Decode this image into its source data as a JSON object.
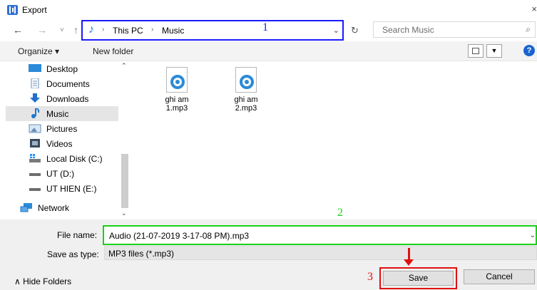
{
  "window": {
    "title": "Export",
    "close_glyph": "×"
  },
  "nav": {
    "back": "←",
    "forward": "→",
    "recent": "˅",
    "up": "↑"
  },
  "address": {
    "crumbs": [
      "This PC",
      "Music"
    ],
    "separator": "›",
    "icon": "music-note-icon"
  },
  "annotations": {
    "address": "1",
    "filename": "2",
    "save": "3"
  },
  "search": {
    "placeholder": "Search Music"
  },
  "toolbar": {
    "organize": "Organize ▾",
    "new_folder": "New folder",
    "help": "?"
  },
  "sidebar": {
    "items": [
      {
        "label": "Desktop",
        "icon": "desktop-icon"
      },
      {
        "label": "Documents",
        "icon": "documents-icon"
      },
      {
        "label": "Downloads",
        "icon": "downloads-icon"
      },
      {
        "label": "Music",
        "icon": "music-icon",
        "selected": true
      },
      {
        "label": "Pictures",
        "icon": "pictures-icon"
      },
      {
        "label": "Videos",
        "icon": "videos-icon"
      },
      {
        "label": "Local Disk (C:)",
        "icon": "local-disk-icon"
      },
      {
        "label": "UT (D:)",
        "icon": "drive-icon"
      },
      {
        "label": "UT HIEN (E:)",
        "icon": "drive-icon"
      },
      {
        "label": "Network",
        "icon": "network-icon"
      }
    ]
  },
  "files": [
    {
      "name_line1": "ghi am",
      "name_line2": "1.mp3"
    },
    {
      "name_line1": "ghi am",
      "name_line2": "2.mp3"
    }
  ],
  "form": {
    "file_name_label": "File name:",
    "file_name_value": "Audio (21-07-2019 3-17-08 PM).mp3",
    "save_type_label": "Save as type:",
    "save_type_value": "MP3 files (*.mp3)"
  },
  "footer": {
    "hide_folders": "∧  Hide Folders",
    "save": "Save",
    "cancel": "Cancel"
  },
  "colors": {
    "annotation_blue": "#1a1aff",
    "annotation_green": "#17d117",
    "annotation_red": "#e01010",
    "icon_blue": "#2a8ad8"
  }
}
